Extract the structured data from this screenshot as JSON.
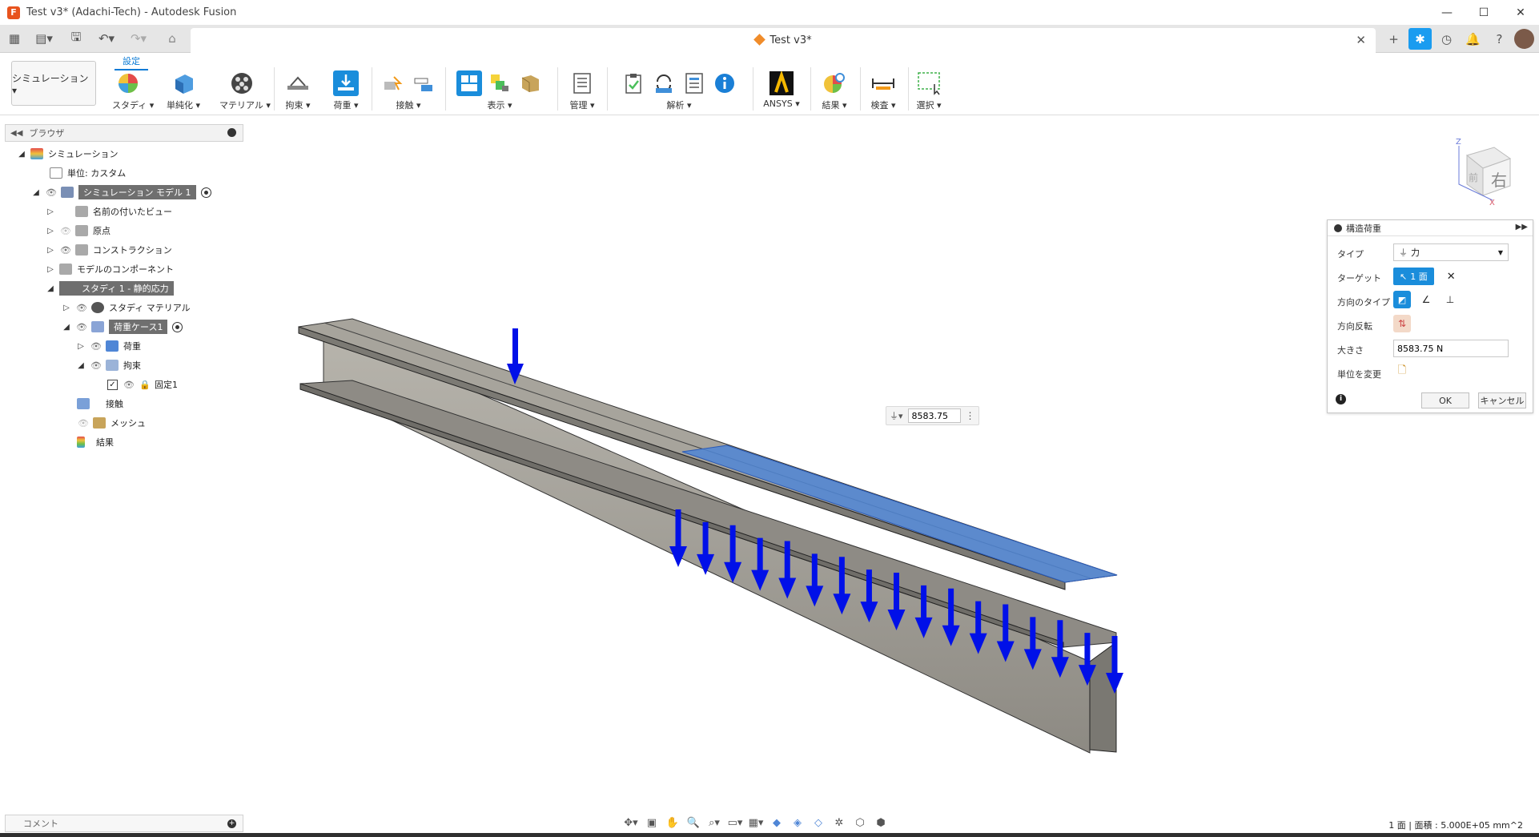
{
  "window": {
    "title": "Test v3* (Adachi-Tech) - Autodesk Fusion",
    "minimize": "—",
    "maximize": "☐",
    "close": "✕"
  },
  "doc_tab": {
    "title": "Test v3*",
    "close": "✕"
  },
  "ribbon": {
    "workspace": "シミュレーション ▾",
    "active_tab": "設定",
    "groups": [
      "スタディ ▾",
      "単純化 ▾",
      "マテリアル ▾",
      "拘束 ▾",
      "荷重 ▾",
      "接触 ▾",
      "表示 ▾",
      "管理 ▾",
      "解析 ▾",
      "ANSYS ▾",
      "結果 ▾",
      "検査 ▾",
      "選択 ▾"
    ]
  },
  "browser": {
    "header": "ブラウザ",
    "items": [
      {
        "label": "シミュレーション"
      },
      {
        "label": "単位: カスタム"
      },
      {
        "label": "シミュレーション モデル 1"
      },
      {
        "label": "名前の付いたビュー"
      },
      {
        "label": "原点"
      },
      {
        "label": "コンストラクション"
      },
      {
        "label": "モデルのコンポーネント"
      },
      {
        "label": "スタディ 1 - 静的応力"
      },
      {
        "label": "スタディ マテリアル"
      },
      {
        "label": "荷重ケース1"
      },
      {
        "label": "荷重"
      },
      {
        "label": "拘束"
      },
      {
        "label": "固定1"
      },
      {
        "label": "接触"
      },
      {
        "label": "メッシュ"
      },
      {
        "label": "結果"
      }
    ]
  },
  "viewcube": {
    "face_right": "右",
    "face_front": "前",
    "axis_z": "Z",
    "axis_x": "X"
  },
  "floating_input": {
    "value": "8583.75"
  },
  "dialog": {
    "title": "構造荷重",
    "type_label": "タイプ",
    "type_value": "力",
    "target_label": "ターゲット",
    "target_value": "1 面",
    "direction_type_label": "方向のタイプ",
    "flip_label": "方向反転",
    "magnitude_label": "大きさ",
    "magnitude_value": "8583.75 N",
    "unit_label": "単位を変更",
    "ok": "OK",
    "cancel": "キャンセル"
  },
  "comment": {
    "label": "コメント"
  },
  "status": {
    "text": "1 面 | 面積 : 5.000E+05 mm^2"
  },
  "colors": {
    "accent": "#1a8ddb",
    "arrow": "#0010e8",
    "face": "#4f86d6",
    "beam": "#9c9a93"
  }
}
